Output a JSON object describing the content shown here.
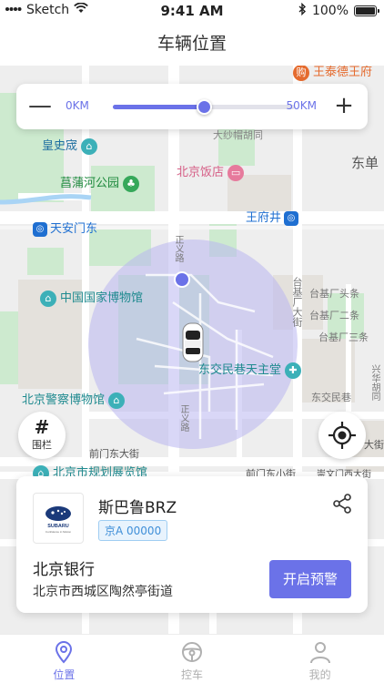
{
  "status_bar": {
    "carrier": "Sketch",
    "time": "9:41 AM",
    "battery": "100%",
    "battery_level": 1.0
  },
  "nav": {
    "title": "车辆位置"
  },
  "map": {
    "labels": {
      "top_partial": "王泰德王府",
      "huangshicheng": "皇史宬",
      "dashaqiao": "大纱帽胡同",
      "dongdan": "东单",
      "changpu": "菖蒲河公园",
      "beijing_hotel": "北京饭店",
      "tiananmen_east": "天安门东",
      "wangfujing": "王府井",
      "zhengyi_road_north": "正义路",
      "national_museum": "中国国家博物馆",
      "taiji_changtou": "台基厂头条",
      "taiji_changer": "台基厂二条",
      "taiji_changsan": "台基厂三条",
      "taiji_dajie": "台基厂大街",
      "dongjiaominxiang_church": "东交民巷天主堂",
      "dongjiaominxiang": "东交民巷",
      "police_museum": "北京警察博物馆",
      "zhengyi_road_south": "正义路",
      "qianmen_east": "前门东大街",
      "dajie_right": "大街",
      "planning_hall": "北京市规划展览馆",
      "qianmen_dongxiao": "前门东小街",
      "chongwenmen": "崇文门西大街",
      "hetong_right": "兴华胡同"
    }
  },
  "radius": {
    "min_label": "0KM",
    "max_label": "50KM",
    "value_fraction": 0.5,
    "minus_symbol": "—",
    "plus_symbol": "+"
  },
  "fence": {
    "glyph": "#",
    "label": "围栏"
  },
  "vehicle": {
    "name": "斯巴鲁BRZ",
    "plate": "京A 00000",
    "brand": "SUBARU",
    "brand_tagline": "Confidence in Motion",
    "location_name": "北京银行",
    "address": "北京市西城区陶然亭街道",
    "alarm_button": "开启预警"
  },
  "tabs": [
    {
      "label": "位置",
      "icon": "location-pin-icon",
      "active": true
    },
    {
      "label": "控车",
      "icon": "steering-wheel-icon",
      "active": false
    },
    {
      "label": "我的",
      "icon": "user-icon",
      "active": false
    }
  ],
  "colors": {
    "accent": "#6b72e8",
    "fence_fill": "#b9b7f0",
    "park": "#cdeacf",
    "road": "#ffffff",
    "metro": "#1f6fd1",
    "poi_teal": "#3cb0b8",
    "poi_green": "#36a85a",
    "poi_pink": "#e67a9c"
  }
}
